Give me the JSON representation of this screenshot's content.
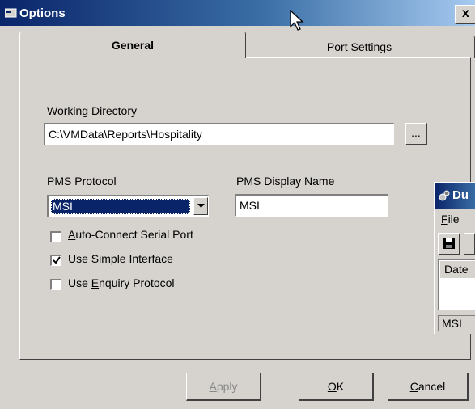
{
  "window": {
    "title": "Options",
    "close_label": "x"
  },
  "tabs": [
    {
      "label": "General",
      "selected": true
    },
    {
      "label": "Port Settings",
      "selected": false
    }
  ],
  "general": {
    "working_directory": {
      "label": "Working Directory",
      "value": "C:\\VMData\\Reports\\Hospitality",
      "browse_label": "..."
    },
    "pms_protocol": {
      "label": "PMS Protocol",
      "selected_value": "MSI"
    },
    "pms_display_name": {
      "label": "PMS Display Name",
      "value": "MSI"
    },
    "checkboxes": [
      {
        "key": "A",
        "rest": "uto-Connect Serial Port",
        "checked": false
      },
      {
        "key": "U",
        "rest": "se Simple Interface",
        "checked": true
      },
      {
        "pre": "Use ",
        "key": "E",
        "rest": "nquiry Protocol",
        "checked": false
      }
    ]
  },
  "buttons": {
    "apply": {
      "key": "A",
      "rest": "pply",
      "enabled": false
    },
    "ok": {
      "key": "O",
      "rest": "K"
    },
    "cancel": {
      "key": "C",
      "rest": "ancel"
    }
  },
  "background_window": {
    "title_fragment": "Du",
    "menu_fragment": "File",
    "menu_key": "F",
    "menu_rest": "ile",
    "column_fragment": "Date",
    "status_fragment": "MSI"
  },
  "colors": {
    "title_bar": "#0a246a",
    "selection": "#0a246a",
    "face": "#d6d3ce"
  }
}
